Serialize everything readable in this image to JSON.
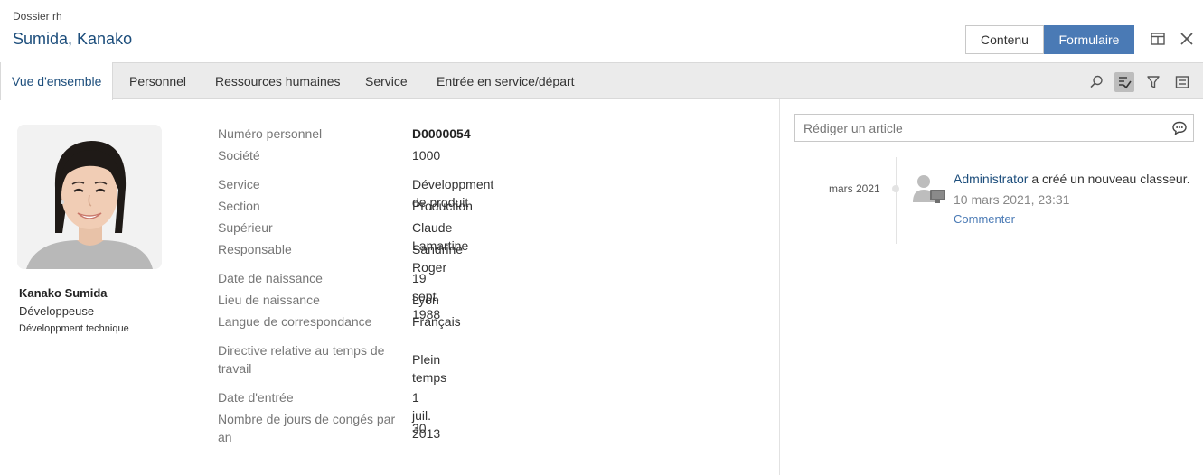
{
  "header": {
    "breadcrumb": "Dossier rh",
    "title": "Sumida, Kanako",
    "buttons": {
      "contenu": "Contenu",
      "formulaire": "Formulaire"
    }
  },
  "tabs": [
    {
      "label": "Vue d'ensemble",
      "active": true
    },
    {
      "label": "Personnel",
      "active": false
    },
    {
      "label": "Ressources humaines",
      "active": false
    },
    {
      "label": "Service",
      "active": false
    },
    {
      "label": "Entrée en service/départ",
      "active": false
    }
  ],
  "toolbar_icons": [
    "search-icon",
    "checklist-icon",
    "filter-icon",
    "list-icon"
  ],
  "profile": {
    "name": "Kanako Sumida",
    "role": "Développeuse",
    "department": "Développment technique"
  },
  "fields": [
    {
      "label": "Numéro personnel",
      "value": "D0000054"
    },
    {
      "label": "Société",
      "value": "1000"
    },
    {
      "label": "Service",
      "value": "Développment de produit"
    },
    {
      "label": "Section",
      "value": "Production"
    },
    {
      "label": "Supérieur",
      "value": "Claude Lamartine"
    },
    {
      "label": "Responsable",
      "value": "Sandrine Roger"
    },
    {
      "label": "Date de naissance",
      "value": "19 sept. 1988"
    },
    {
      "label": "Lieu de naissance",
      "value": "Lyon"
    },
    {
      "label": "Langue de correspondance",
      "value": "Français"
    },
    {
      "label": "Directive relative au temps de travail",
      "value": "Plein temps"
    },
    {
      "label": "Date d'entrée",
      "value": "1 juil. 2013"
    },
    {
      "label": "Nombre de jours de congés par an",
      "value": "30"
    }
  ],
  "feed": {
    "compose_placeholder": "Rédiger un article",
    "entries": [
      {
        "date_label": "mars 2021",
        "user": "Administrator",
        "action": " a créé un nouveau classeur.",
        "timestamp": "10 mars 2021, 23:31",
        "comment_link": "Commenter"
      }
    ]
  },
  "colors": {
    "accent": "#1d4e7c",
    "primary_button": "#4a7ab5",
    "tabbar_bg": "#ebebeb"
  }
}
